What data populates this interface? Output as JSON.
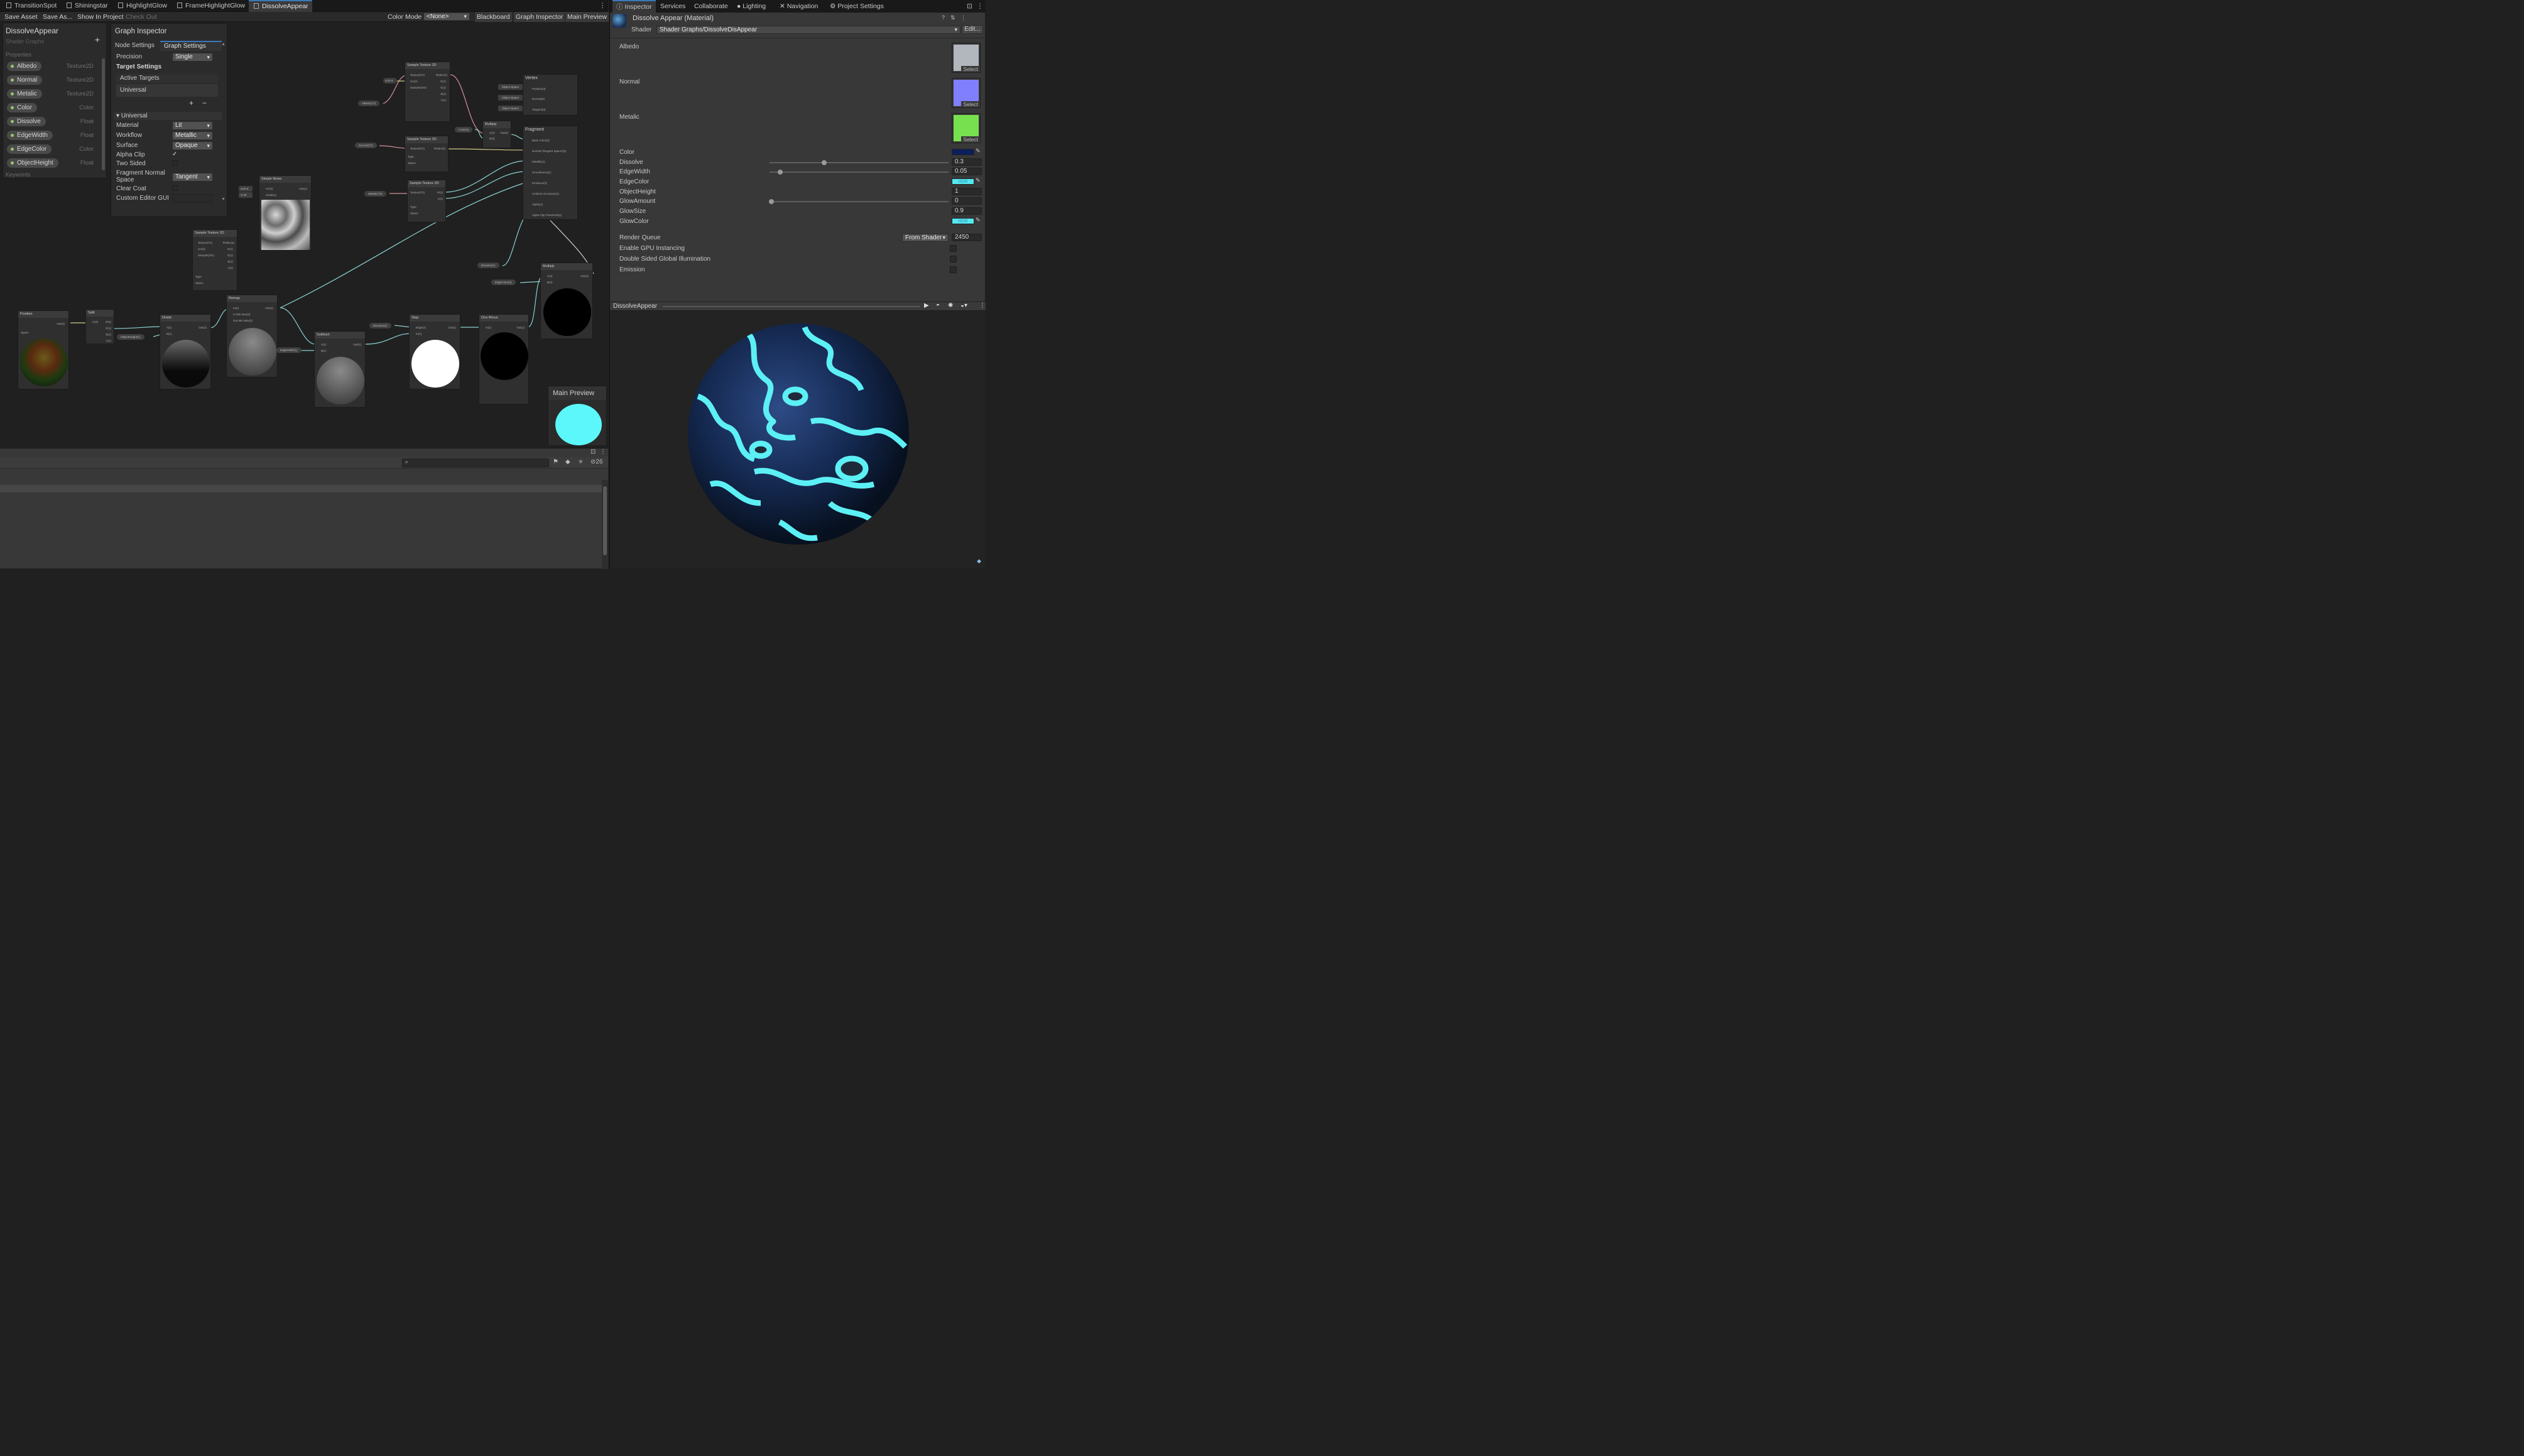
{
  "tabs": [
    {
      "label": "TransitionSpot"
    },
    {
      "label": "Shiningstar"
    },
    {
      "label": "HighlightGlow"
    },
    {
      "label": "FrameHighlightGlow"
    },
    {
      "label": "DissolveAppear"
    }
  ],
  "toolbar": {
    "save_asset": "Save Asset",
    "save_as": "Save As...",
    "show_in_project": "Show In Project",
    "check_out": "Check Out",
    "color_mode_label": "Color Mode",
    "color_mode_value": "<None>",
    "blackboard": "Blackboard",
    "graph_inspector": "Graph Inspector",
    "main_preview": "Main Preview"
  },
  "blackboard": {
    "title": "DissolveAppear",
    "subtitle": "Shader Graphs",
    "properties_header": "Properties",
    "keywords_header": "Keywords",
    "properties": [
      {
        "name": "Albedo",
        "type": "Texture2D"
      },
      {
        "name": "Normal",
        "type": "Texture2D"
      },
      {
        "name": "Metalic",
        "type": "Texture2D"
      },
      {
        "name": "Color",
        "type": "Color"
      },
      {
        "name": "Dissolve",
        "type": "Float"
      },
      {
        "name": "EdgeWidth",
        "type": "Float"
      },
      {
        "name": "EdgeColor",
        "type": "Color"
      },
      {
        "name": "ObjectHeight",
        "type": "Float"
      }
    ]
  },
  "graph_inspector": {
    "title": "Graph Inspector",
    "tab_node": "Node Settings",
    "tab_graph": "Graph Settings",
    "precision_label": "Precision",
    "precision_value": "Single",
    "target_settings": "Target Settings",
    "active_targets": "Active Targets",
    "target_universal": "Universal",
    "universal_section": "Universal",
    "material_label": "Material",
    "material_value": "Lit",
    "workflow_label": "Workflow",
    "workflow_value": "Metallic",
    "surface_label": "Surface",
    "surface_value": "Opaque",
    "alpha_clip": "Alpha Clip",
    "two_sided": "Two Sided",
    "fragment_normal": "Fragment Normal",
    "fragment_normal_2": "Space",
    "fragment_normal_value": "Tangent",
    "clear_coat": "Clear Coat",
    "custom_editor": "Custom Editor GUI"
  },
  "nodes": {
    "sample1": "Sample Texture 2D",
    "sample2": "Sample Texture 2D",
    "sample3": "Sample Texture 2D",
    "sample4": "Sample Texture 2D",
    "vertex": "Vertex",
    "fragment": "Fragment",
    "multiply1": "Multiply",
    "multiply2": "Multiply",
    "simple_noise": "Simple Noise",
    "position": "Position",
    "split": "Split",
    "divide": "Divide",
    "remap": "Remap",
    "subtract": "Subtract",
    "step": "Step",
    "one_minus": "One Minus",
    "main_preview": "Main Preview",
    "pill_albedo": "Albedo(T2)",
    "pill_normal": "Normal(T2)",
    "pill_metalic": "Metalic(T2)",
    "pill_color": "Color(4)",
    "pill_dissolve1": "Dissolve(1)",
    "pill_dissolve2": "Dissolve(1)",
    "pill_edgecolor": "EdgeColor(4)",
    "pill_objheight": "ObjectHeight(1)",
    "pill_edgewidth": "EdgeWidth(1)",
    "vertex_ports": [
      "Position(3)",
      "Normal(3)",
      "Tangent(3)"
    ],
    "vertex_inputs": [
      "Object Space",
      "Object Space",
      "Object Space"
    ],
    "fragment_ports": [
      "Base Color(3)",
      "Normal (Tangent Space)(3)",
      "Metallic(1)",
      "Smoothness(1)",
      "Emission(3)",
      "Ambient Occlusion(1)",
      "Alpha(1)",
      "Alpha Clip Threshold(1)"
    ]
  },
  "console": {
    "count": "26"
  },
  "inspector": {
    "tabs": [
      "Inspector",
      "Services",
      "Collaborate",
      "Lighting",
      "Navigation",
      "Project Settings"
    ],
    "material_title": "Dissolve Appear (Material)",
    "shader_label": "Shader",
    "shader_value": "Shader Graphs/DissolveDisAppear",
    "edit": "Edit...",
    "albedo": "Albedo",
    "normal": "Normal",
    "metalic": "Metalic",
    "select": "Select",
    "color": "Color",
    "dissolve": "Dissolve",
    "dissolve_value": "0.3",
    "edgewidth": "EdgeWidth",
    "edgewidth_value": "0.05",
    "edgecolor": "EdgeColor",
    "hdr": "HDR",
    "objectheight": "ObjectHeight",
    "objectheight_value": "1",
    "glowamount": "GlowAmount",
    "glowamount_value": "0",
    "glowsize": "GlowSize",
    "glowsize_value": "0.9",
    "glowcolor": "GlowColor",
    "render_queue": "Render Queue",
    "render_queue_mode": "From Shader",
    "render_queue_value": "2450",
    "gpu_instancing": "Enable GPU Instancing",
    "double_sided_gi": "Double Sided Global Illumination",
    "emission": "Emission",
    "preview_title": "DissolveAppear"
  },
  "colors": {
    "albedo_swatch": "#b2b6bd",
    "normal_swatch": "#8080ff",
    "metalic_swatch": "#77e04f",
    "color_swatch": "#0c1f5c",
    "edge_color": "#55e8f2",
    "glow_color": "#55e8f2",
    "preview_sphere": "#5cf7fb"
  }
}
